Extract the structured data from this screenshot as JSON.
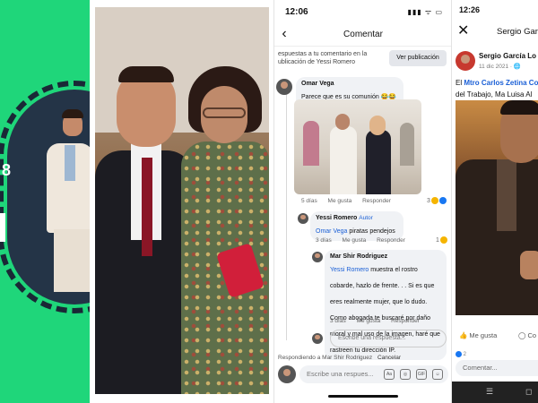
{
  "panel1": {
    "number": "8",
    "bar": ""
  },
  "panel3": {
    "status": {
      "time": "12:06",
      "icons": "▮▮▮ ᯤ ▭"
    },
    "header": {
      "back": "‹",
      "title": "Comentar"
    },
    "reply_info": "espuestas a tu comentario en la ublicación de Yessi Romero",
    "view_post": "Ver publicación",
    "comments": [
      {
        "name": "Omar Vega",
        "text": "Parece que es su comunión 😂😂😂",
        "meta": [
          "5 días",
          "Me gusta",
          "Responder"
        ],
        "reactions": "3"
      },
      {
        "name": "Yessi Romero",
        "author_badge": "Autor",
        "mention": "Omar Vega",
        "text": "piratas pendejos",
        "meta": [
          "3 días",
          "Me gusta",
          "Responder"
        ],
        "reactions": "1"
      },
      {
        "name": "Mar Shir Rodriguez",
        "mention": "Yessi Romero",
        "text": "muestra el rostro cobarde, hazlo de frente. . . Si es que eres realmente mujer, que lo dudo. Como abogada te buscaré por daño moral y mal uso de la imagen, haré que rastreen tu dirección IP.",
        "meta": [
          "3 días",
          "Me gusta",
          "Responder"
        ]
      }
    ],
    "reply_placeholder": "Escribe una respuesta...",
    "replying_to": "Respondiendo a Mar Shir Rodriguez",
    "cancel": "Cancelar",
    "compose_placeholder": "Escribe una respues...",
    "compose_icons": [
      "Aa",
      "◎",
      "GIF",
      "☺"
    ]
  },
  "panel4": {
    "status": {
      "time": "12:26"
    },
    "header": {
      "close": "✕",
      "title": "Sergio Gar"
    },
    "post": {
      "author": "Sergio García Lo",
      "date": "11 dic 2021 · 🌐",
      "text_prefix": "El ",
      "link": "Mtro Carlos Zetina Co",
      "text_line2": "del Trabajo, Ma Luisa Al"
    },
    "actions": {
      "like": "👍 Me gusta",
      "comment": "◯ Co"
    },
    "reactions": "2",
    "compose_placeholder": "Comentar...",
    "nav": [
      "☰",
      "◻"
    ]
  }
}
